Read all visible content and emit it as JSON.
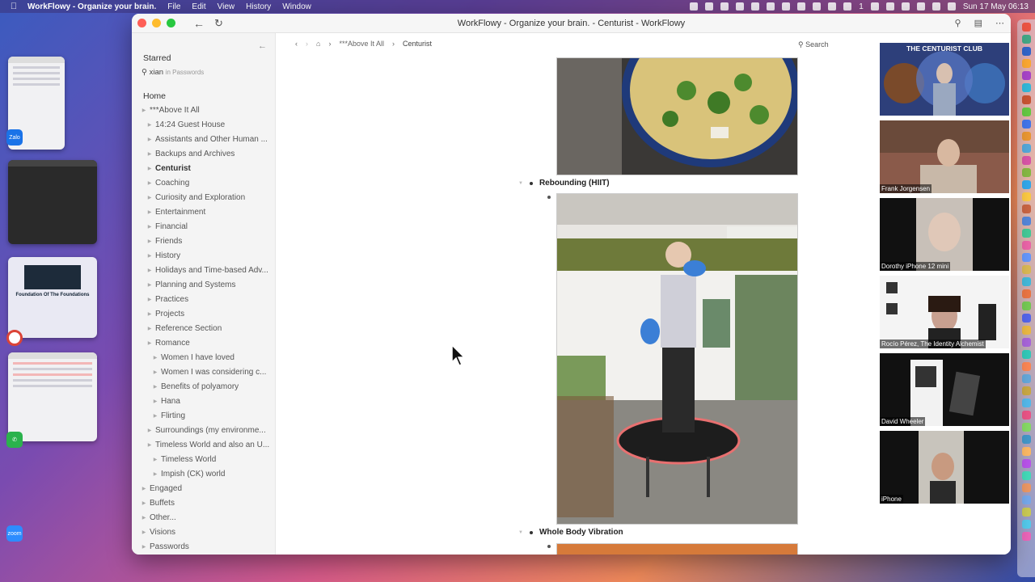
{
  "menubar": {
    "app": "WorkFlowy - Organize your brain.",
    "menus": [
      "File",
      "Edit",
      "View",
      "History",
      "Window"
    ],
    "date_time": "Sun 17 May  06:13",
    "badge_count": "1"
  },
  "desktop": {
    "thumb_text": "Foundation Of The Foundations",
    "zalo_label": "Zalo",
    "zoom_label": "zoom"
  },
  "window": {
    "title": "WorkFlowy - Organize your brain. - Centurist - WorkFlowy"
  },
  "sidebar": {
    "starred": "Starred",
    "search_term": "xian",
    "search_scope": "in Passwords",
    "home": "Home",
    "items": [
      {
        "label": "***Above It All",
        "level": 1
      },
      {
        "label": "14:24 Guest House",
        "level": 2
      },
      {
        "label": "Assistants and Other Human ...",
        "level": 2
      },
      {
        "label": "Backups and Archives",
        "level": 2
      },
      {
        "label": "Centurist",
        "level": 2,
        "bold": true
      },
      {
        "label": "Coaching",
        "level": 2
      },
      {
        "label": "Curiosity and Exploration",
        "level": 2
      },
      {
        "label": "Entertainment",
        "level": 2
      },
      {
        "label": "Financial",
        "level": 2
      },
      {
        "label": "Friends",
        "level": 2
      },
      {
        "label": "History",
        "level": 2
      },
      {
        "label": "Holidays and Time-based Adv...",
        "level": 2
      },
      {
        "label": "Planning and Systems",
        "level": 2
      },
      {
        "label": "Practices",
        "level": 2
      },
      {
        "label": "Projects",
        "level": 2
      },
      {
        "label": "Reference Section",
        "level": 2
      },
      {
        "label": "Romance",
        "level": 2
      },
      {
        "label": "Women I have loved",
        "level": 3
      },
      {
        "label": "Women I was considering c...",
        "level": 3
      },
      {
        "label": "Benefits of polyamory",
        "level": 3
      },
      {
        "label": "Hana",
        "level": 3
      },
      {
        "label": "Flirting",
        "level": 3
      },
      {
        "label": "Surroundings (my environme...",
        "level": 2
      },
      {
        "label": "Timeless World and also an U...",
        "level": 2
      },
      {
        "label": "Timeless World",
        "level": 3
      },
      {
        "label": "Impish (CK) world",
        "level": 3
      },
      {
        "label": "Engaged",
        "level": 1
      },
      {
        "label": "Buffets",
        "level": 1
      },
      {
        "label": "Other...",
        "level": 1
      },
      {
        "label": "Visions",
        "level": 1
      },
      {
        "label": "Passwords",
        "level": 1
      }
    ]
  },
  "breadcrumb": {
    "parent": "***Above It All",
    "current": "Centurist"
  },
  "search_label": "Search",
  "content": {
    "item1": "Rebounding (HIIT)",
    "item2": "Whole Body Vibration"
  },
  "zoom_tiles": [
    {
      "name": "",
      "banner": "THE CENTURIST CLUB"
    },
    {
      "name": "Frank Jorgensen"
    },
    {
      "name": "Dorothy iPhone 12 mini"
    },
    {
      "name": "Rocío Pérez, The Identity Alchemist"
    },
    {
      "name": "David Wheeler"
    },
    {
      "name": "iPhone"
    }
  ]
}
